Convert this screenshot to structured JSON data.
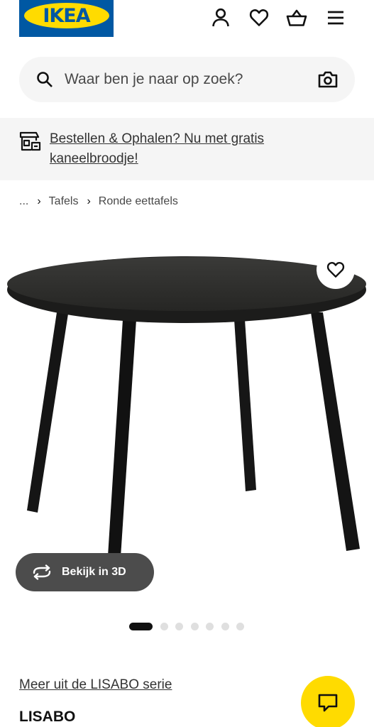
{
  "header": {
    "logo_text": "IKEA",
    "colors": {
      "brand_blue": "#0058a3",
      "brand_yellow": "#ffdb00"
    },
    "icons": [
      "user-icon",
      "heart-icon",
      "basket-icon",
      "menu-icon"
    ]
  },
  "search": {
    "placeholder": "Waar ben je naar op zoek?",
    "icons": [
      "search-icon",
      "camera-icon"
    ]
  },
  "banner": {
    "text": "Bestellen & Ophalen? Nu met gratis kaneelbroodje!",
    "icon": "store-pickup-icon"
  },
  "breadcrumb": {
    "items": [
      "...",
      "Tafels",
      "Ronde eettafels"
    ]
  },
  "product_media": {
    "favourite_icon": "heart-icon",
    "view_3d_label": "Bekijk in 3D",
    "view_3d_icon": "rotate-3d-icon",
    "carousel": {
      "total": 7,
      "active": 1
    }
  },
  "product": {
    "series_link": "Meer uit de LISABO serie",
    "name": "LISABO"
  },
  "chat": {
    "icon": "chat-icon",
    "color": "#ffdb00"
  }
}
